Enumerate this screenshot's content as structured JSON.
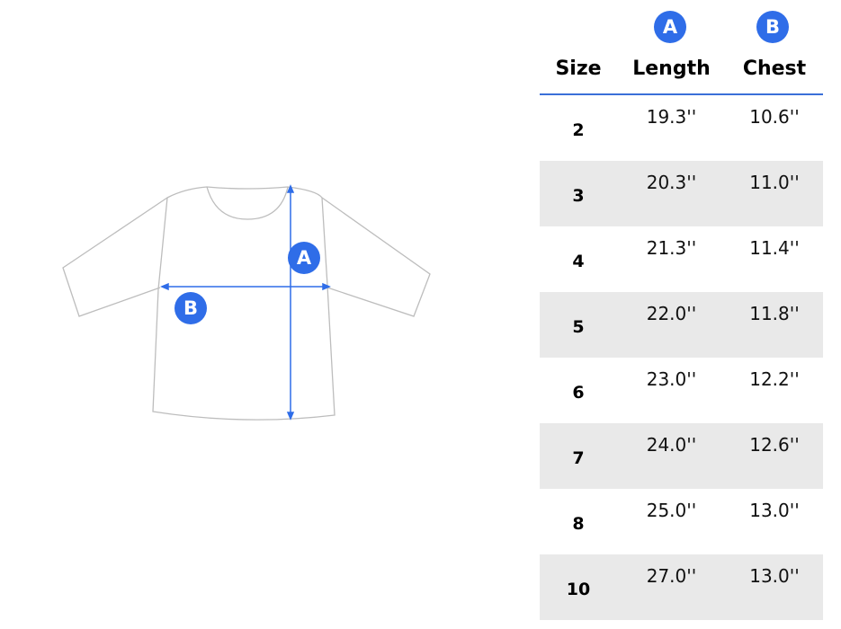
{
  "diagram": {
    "labels": {
      "a": "A",
      "b": "B"
    },
    "colors": {
      "accent": "#2f6de8",
      "outline": "#bdbdbd"
    }
  },
  "table": {
    "header_badges": {
      "length": "A",
      "chest": "B"
    },
    "headers": {
      "size": "Size",
      "length": "Length",
      "chest": "Chest"
    },
    "rows": [
      {
        "size": "2",
        "length": "19.3''",
        "chest": "10.6''"
      },
      {
        "size": "3",
        "length": "20.3''",
        "chest": "11.0''"
      },
      {
        "size": "4",
        "length": "21.3''",
        "chest": "11.4''"
      },
      {
        "size": "5",
        "length": "22.0''",
        "chest": "11.8''"
      },
      {
        "size": "6",
        "length": "23.0''",
        "chest": "12.2''"
      },
      {
        "size": "7",
        "length": "24.0''",
        "chest": "12.6''"
      },
      {
        "size": "8",
        "length": "25.0''",
        "chest": "13.0''"
      },
      {
        "size": "10",
        "length": "27.0''",
        "chest": "13.0''"
      }
    ]
  }
}
